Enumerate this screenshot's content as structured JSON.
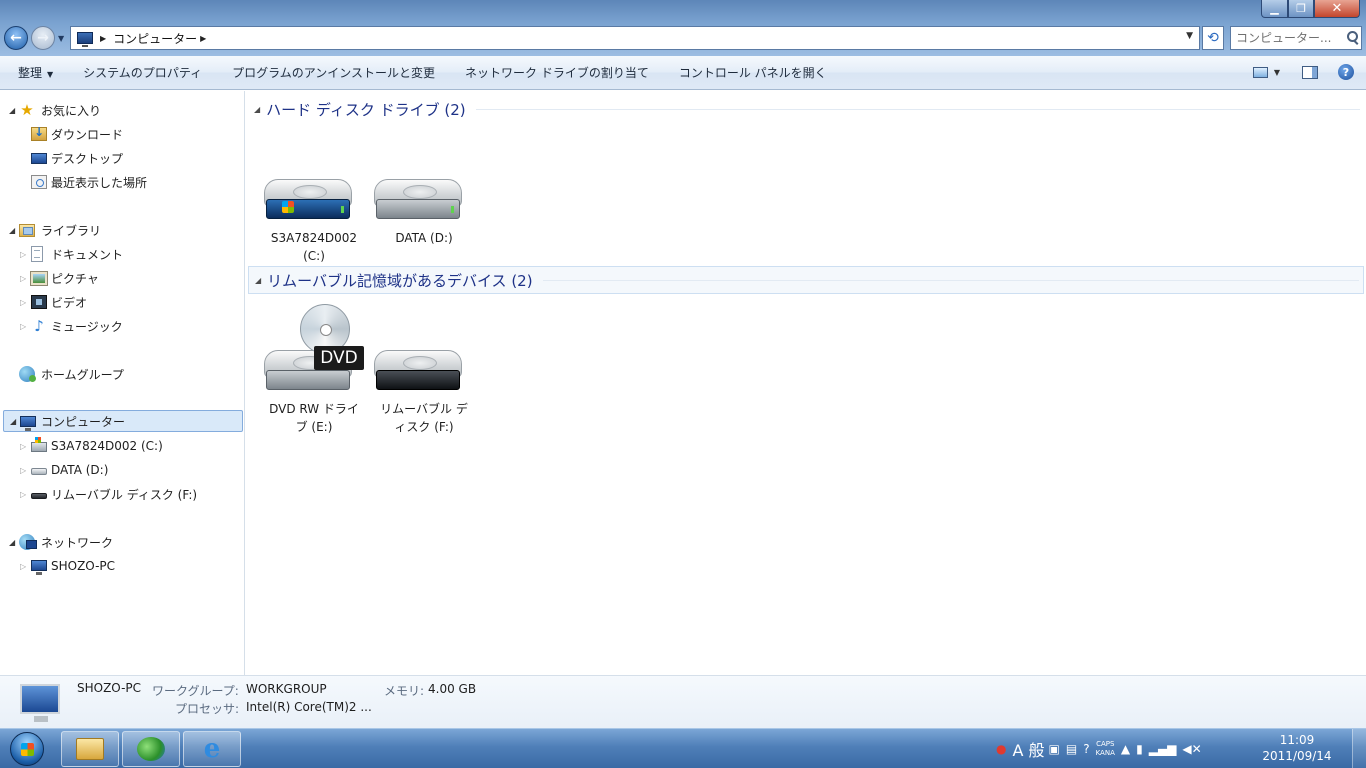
{
  "window": {
    "minimize_glyph": "▁",
    "maximize_glyph": "❐",
    "close_glyph": "✕"
  },
  "address": {
    "crumb": "コンピューター",
    "search_placeholder": "コンピューター..."
  },
  "toolbar": {
    "organize": "整理",
    "system_properties": "システムのプロパティ",
    "uninstall": "プログラムのアンインストールと変更",
    "map_drive": "ネットワーク ドライブの割り当て",
    "control_panel": "コントロール パネルを開く"
  },
  "nav": {
    "favorites": "お気に入り",
    "downloads": "ダウンロード",
    "desktop": "デスクトップ",
    "recent": "最近表示した場所",
    "libraries": "ライブラリ",
    "documents": "ドキュメント",
    "pictures": "ピクチャ",
    "videos": "ビデオ",
    "music": "ミュージック",
    "homegroup": "ホームグループ",
    "computer": "コンピューター",
    "drive_c": "S3A7824D002 (C:)",
    "drive_d": "DATA (D:)",
    "drive_f": "リムーバブル ディスク (F:)",
    "network": "ネットワーク",
    "pc": "SHOZO-PC"
  },
  "content": {
    "hdd_header": "ハード ディスク ドライブ (2)",
    "removable_header": "リムーバブル記憶域があるデバイス (2)",
    "drive_c_line1": "S3A7824D002",
    "drive_c_line2": "(C:)",
    "drive_d": "DATA (D:)",
    "dvd_line1": "DVD RW ドライ",
    "dvd_line2": "ブ (E:)",
    "dvd_badge": "DVD",
    "removable_line1": "リムーバブル デ",
    "removable_line2": "ィスク (F:)"
  },
  "details": {
    "computer_name": "SHOZO-PC",
    "workgroup_key": "ワークグループ:",
    "workgroup_val": "WORKGROUP",
    "memory_key": "メモリ:",
    "memory_val": "4.00 GB",
    "processor_key": "プロセッサ:",
    "processor_val": "Intel(R) Core(TM)2 ..."
  },
  "taskbar": {
    "ie_glyph": "e",
    "ime": "A 般",
    "caps": "CAPS",
    "kana": "KANA",
    "time": "11:09",
    "date": "2011/09/14"
  }
}
